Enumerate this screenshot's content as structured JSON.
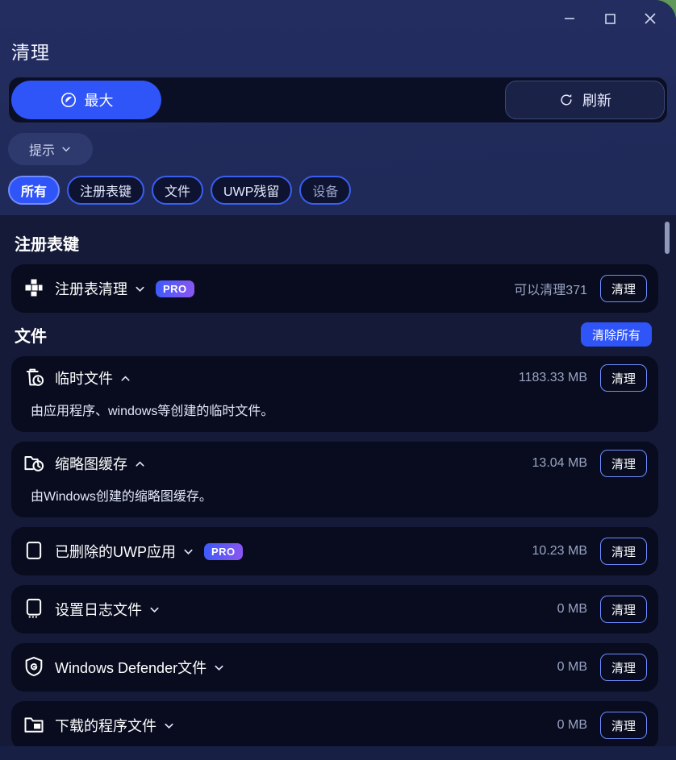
{
  "window": {
    "title": "清理",
    "controls": [
      {
        "name": "minimize",
        "glyph": "minimize-icon"
      },
      {
        "name": "maximize",
        "glyph": "maximize-icon"
      },
      {
        "name": "close",
        "glyph": "close-icon"
      }
    ]
  },
  "actionbar": {
    "primary_label": "最大",
    "primary_icon": "gauge-icon",
    "refresh_label": "刷新",
    "refresh_icon": "refresh-icon"
  },
  "tip": {
    "label": "提示",
    "chevron": "chevron-down-icon"
  },
  "tabs": [
    {
      "label": "所有",
      "active": true
    },
    {
      "label": "注册表键",
      "active": false
    },
    {
      "label": "文件",
      "active": false
    },
    {
      "label": "UWP残留",
      "active": false
    },
    {
      "label": "设备",
      "active": false,
      "muted": true
    }
  ],
  "sections": [
    {
      "title": "注册表键",
      "action": null,
      "items": [
        {
          "icon": "registry-icon",
          "name": "注册表清理",
          "chevron": "chevron-down-icon",
          "pro": "PRO",
          "size": "可以清理371",
          "button": "清理",
          "desc": null
        }
      ]
    },
    {
      "title": "文件",
      "action": "清除所有",
      "items": [
        {
          "icon": "trash-clock-icon",
          "name": "临时文件",
          "chevron": "chevron-up-icon",
          "pro": null,
          "size": "1183.33 MB",
          "button": "清理",
          "desc": "由应用程序、windows等创建的临时文件。"
        },
        {
          "icon": "folder-clock-icon",
          "name": "缩略图缓存",
          "chevron": "chevron-up-icon",
          "pro": null,
          "size": "13.04 MB",
          "button": "清理",
          "desc": "由Windows创建的缩略图缓存。"
        },
        {
          "icon": "app-window-icon",
          "name": "已删除的UWP应用",
          "chevron": "chevron-down-icon",
          "pro": "PRO",
          "size": "10.23 MB",
          "button": "清理",
          "desc": null
        },
        {
          "icon": "log-screen-icon",
          "name": "设置日志文件",
          "chevron": "chevron-down-icon",
          "pro": null,
          "size": "0 MB",
          "button": "清理",
          "desc": null
        },
        {
          "icon": "shield-defender-icon",
          "name": "Windows Defender文件",
          "chevron": "chevron-down-icon",
          "pro": null,
          "size": "0 MB",
          "button": "清理",
          "desc": null
        },
        {
          "icon": "folder-download-icon",
          "name": "下载的程序文件",
          "chevron": "chevron-down-icon",
          "pro": null,
          "size": "0 MB",
          "button": "清理",
          "desc": null
        }
      ]
    }
  ],
  "colors": {
    "accent": "#2f54f7",
    "tab_border": "#3a5ef0",
    "pro_gradient_start": "#3b5bfb",
    "pro_gradient_end": "#8d56f0",
    "content_bg": "#141a38",
    "card_bg": "#080c1e",
    "titlebar_bg": "#222c5e",
    "size_text": "#9aa4c4"
  },
  "scrollbar": {
    "position_percent": 2
  }
}
